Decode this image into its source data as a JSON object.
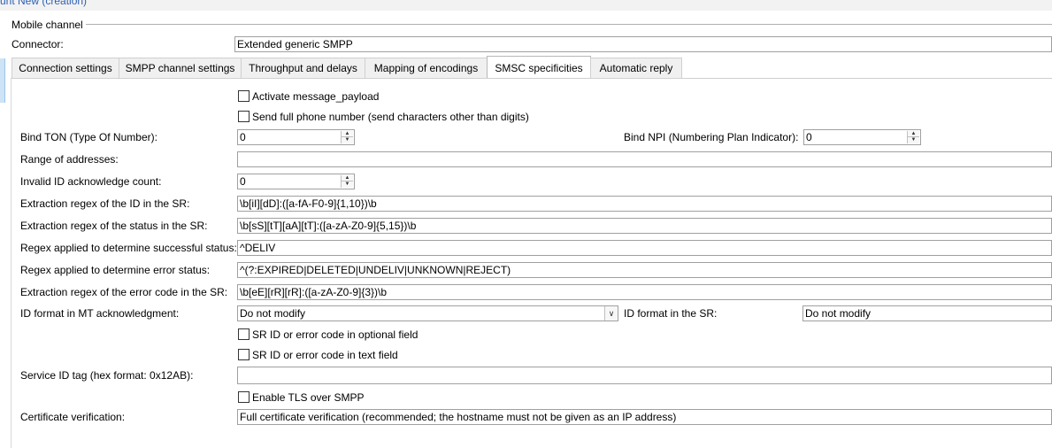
{
  "header": {
    "title": "unt New   (creation)"
  },
  "group": {
    "label": "Mobile channel"
  },
  "connector": {
    "label": "Connector:",
    "value": "Extended generic SMPP"
  },
  "tabs": [
    {
      "label": "Connection settings"
    },
    {
      "label": "SMPP channel settings"
    },
    {
      "label": "Throughput and delays"
    },
    {
      "label": "Mapping of encodings"
    },
    {
      "label": "SMSC specificities"
    },
    {
      "label": "Automatic reply"
    }
  ],
  "form": {
    "activate_payload": "Activate message_payload",
    "send_full_number": "Send full phone number (send characters other than digits)",
    "bind_ton": {
      "label": "Bind TON (Type Of Number):",
      "value": "0"
    },
    "bind_npi": {
      "label": "Bind NPI (Numbering Plan Indicator):",
      "value": "0"
    },
    "range": {
      "label": "Range of addresses:",
      "value": ""
    },
    "invalid_id": {
      "label": "Invalid ID acknowledge count:",
      "value": "0"
    },
    "regex_id": {
      "label": "Extraction regex of the ID in the SR:",
      "value": "\\b[iI][dD]:([a-fA-F0-9]{1,10})\\b"
    },
    "regex_status": {
      "label": "Extraction regex of the status in the SR:",
      "value": "\\b[sS][tT][aA][tT]:([a-zA-Z0-9]{5,15})\\b"
    },
    "regex_success": {
      "label": "Regex applied to determine successful status:",
      "value": "^DELIV"
    },
    "regex_error": {
      "label": "Regex applied to determine error status:",
      "value": "^(?:EXPIRED|DELETED|UNDELIV|UNKNOWN|REJECT)"
    },
    "regex_errcode": {
      "label": "Extraction regex of the error code in the SR:",
      "value": "\\b[eE][rR][rR]:([a-zA-Z0-9]{3})\\b"
    },
    "id_format_mt": {
      "label": "ID format in MT acknowledgment:",
      "value": "Do not modify"
    },
    "id_format_sr": {
      "label": "ID format in the SR:",
      "value": "Do not modify"
    },
    "sr_optional": "SR ID or error code in optional field",
    "sr_text": "SR ID or error code in text field",
    "service_id": {
      "label": "Service ID tag (hex format: 0x12AB):",
      "value": ""
    },
    "enable_tls": "Enable TLS over SMPP",
    "cert": {
      "label": "Certificate verification:",
      "value": "Full certificate verification (recommended; the hostname must not be given as an IP address)"
    }
  }
}
